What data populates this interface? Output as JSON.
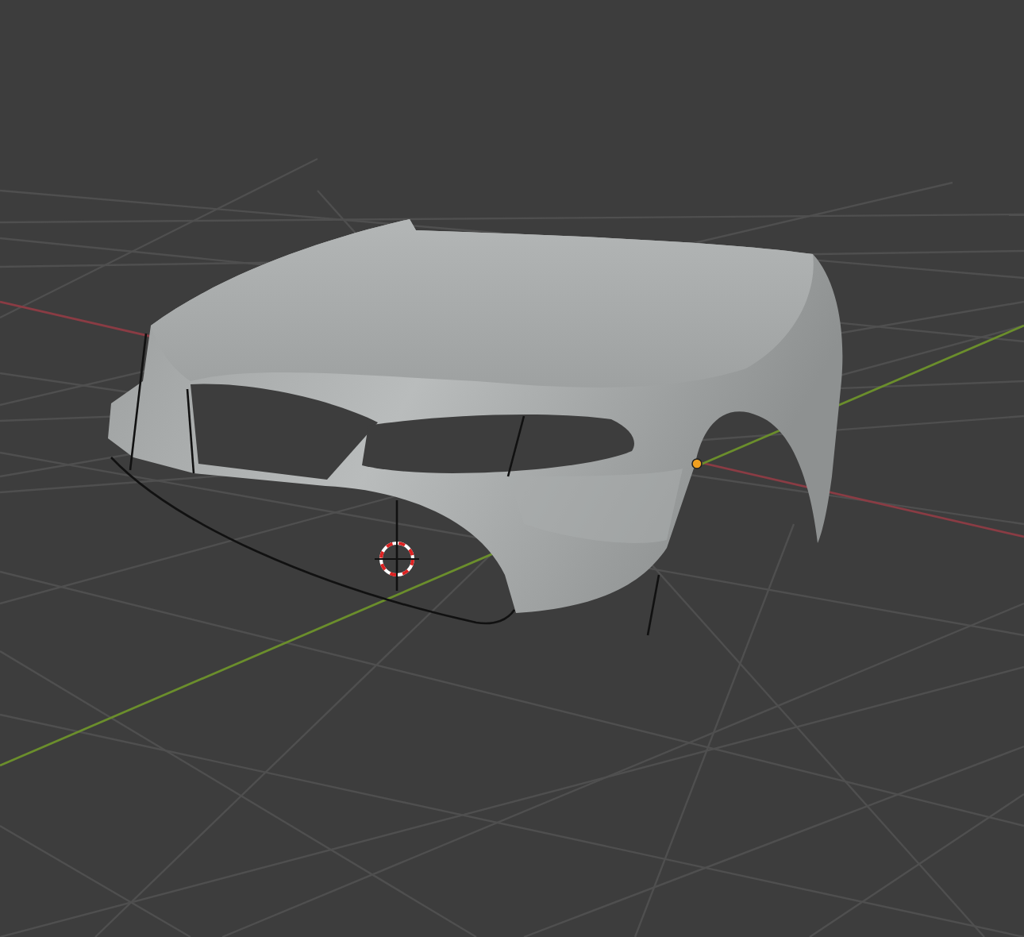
{
  "viewport": {
    "show_grid": true,
    "show_3d_cursor": true,
    "show_origin": true
  }
}
